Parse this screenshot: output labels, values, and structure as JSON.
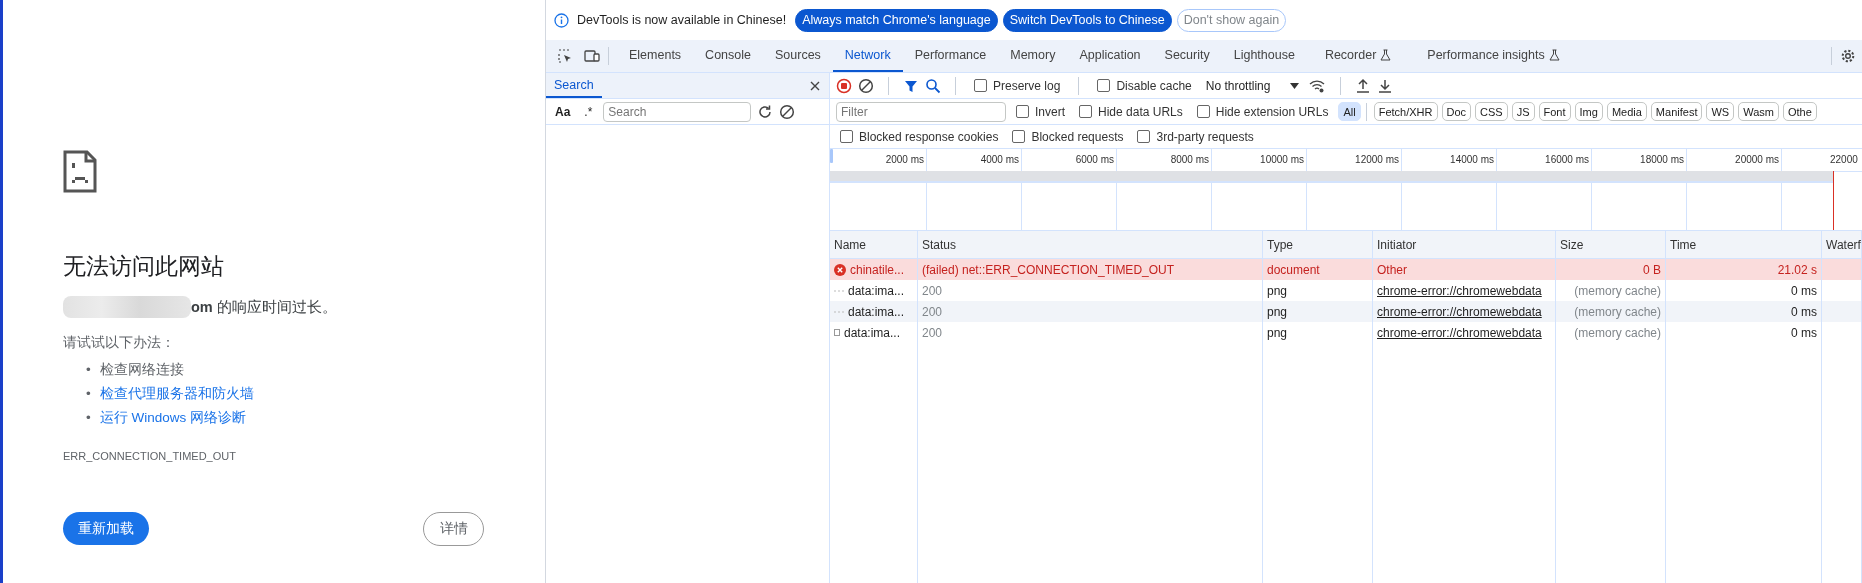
{
  "error_page": {
    "title": "无法访问此网站",
    "message": "**om** 的响应时间过长。",
    "suggestions_heading": "请试试以下办法：",
    "suggestions": [
      {
        "marker": "•",
        "text": "检查网络连接",
        "kind": "text"
      },
      {
        "marker": "•",
        "text": "检查代理服务器和防火墙",
        "kind": "link"
      },
      {
        "marker": "•",
        "text": "运行 Windows 网络诊断",
        "kind": "link"
      }
    ],
    "error_code": "ERR_CONNECTION_TIMED_OUT",
    "reload_button": "重新加载",
    "details_button": "详情"
  },
  "devtools": {
    "infobar": {
      "message": "DevTools is now available in Chinese!",
      "buttons": [
        {
          "label": "Always match Chrome's language",
          "kind": "primary"
        },
        {
          "label": "Switch DevTools to Chinese",
          "kind": "primary"
        },
        {
          "label": "Don't show again",
          "kind": "secondary"
        }
      ]
    },
    "tabs": [
      {
        "label": "Elements",
        "selected": false,
        "experimental": false
      },
      {
        "label": "Console",
        "selected": false,
        "experimental": false
      },
      {
        "label": "Sources",
        "selected": false,
        "experimental": false
      },
      {
        "label": "Network",
        "selected": true,
        "experimental": false
      },
      {
        "label": "Performance",
        "selected": false,
        "experimental": false
      },
      {
        "label": "Memory",
        "selected": false,
        "experimental": false
      },
      {
        "label": "Application",
        "selected": false,
        "experimental": false
      },
      {
        "label": "Security",
        "selected": false,
        "experimental": false
      },
      {
        "label": "Lighthouse",
        "selected": false,
        "experimental": false
      },
      {
        "label": "Recorder",
        "selected": false,
        "experimental": true
      },
      {
        "label": "Performance insights",
        "selected": false,
        "experimental": true
      }
    ],
    "sidebar": {
      "tabs": [
        {
          "label": "Search",
          "selected": true
        }
      ],
      "match_case": "Aa",
      "regex": ".*",
      "search_placeholder": "Search"
    },
    "toolbar": {
      "recording": true,
      "checkboxes": [
        {
          "label": "Preserve log",
          "checked": false
        },
        {
          "label": "Disable cache",
          "checked": false
        }
      ],
      "throttling": "No throttling"
    },
    "filter": {
      "placeholder": "Filter",
      "checkboxes": [
        {
          "label": "Invert",
          "checked": false
        },
        {
          "label": "Hide data URLs",
          "checked": false
        },
        {
          "label": "Hide extension URLs",
          "checked": false
        }
      ],
      "types": [
        {
          "label": "All",
          "selected": true
        },
        {
          "label": "Fetch/XHR",
          "selected": false
        },
        {
          "label": "Doc",
          "selected": false
        },
        {
          "label": "CSS",
          "selected": false
        },
        {
          "label": "JS",
          "selected": false
        },
        {
          "label": "Font",
          "selected": false
        },
        {
          "label": "Img",
          "selected": false
        },
        {
          "label": "Media",
          "selected": false
        },
        {
          "label": "Manifest",
          "selected": false
        },
        {
          "label": "WS",
          "selected": false
        },
        {
          "label": "Wasm",
          "selected": false
        },
        {
          "label": "Othe",
          "selected": false
        }
      ]
    },
    "options": [
      {
        "label": "Blocked response cookies",
        "checked": false
      },
      {
        "label": "Blocked requests",
        "checked": false
      },
      {
        "label": "3rd-party requests",
        "checked": false
      }
    ],
    "timeline": {
      "ticks": [
        "2000 ms",
        "4000 ms",
        "6000 ms",
        "8000 ms",
        "10000 ms",
        "12000 ms",
        "14000 ms",
        "16000 ms",
        "18000 ms",
        "20000 ms",
        "22000"
      ]
    },
    "table": {
      "columns": [
        "Name",
        "Status",
        "Type",
        "Initiator",
        "Size",
        "Time",
        "Waterf"
      ],
      "rows": [
        {
          "kind": "error",
          "failed": true,
          "name": "chinatile...",
          "status": "(failed) net::ERR_CONNECTION_TIMED_OUT",
          "type": "document",
          "initiator": "Other",
          "size": "0 B",
          "time": "21.02 s"
        },
        {
          "kind": "dash",
          "failed": false,
          "name": "data:ima...",
          "status": "200",
          "type": "png",
          "initiator": "chrome-error://chromewebdata",
          "size": "(memory cache)",
          "time": "0 ms"
        },
        {
          "kind": "dash",
          "failed": false,
          "name": "data:ima...",
          "status": "200",
          "type": "png",
          "initiator": "chrome-error://chromewebdata",
          "size": "(memory cache)",
          "time": "0 ms"
        },
        {
          "kind": "file",
          "failed": false,
          "name": "data:ima...",
          "status": "200",
          "type": "png",
          "initiator": "chrome-error://chromewebdata",
          "size": "(memory cache)",
          "time": "0 ms"
        }
      ]
    }
  }
}
